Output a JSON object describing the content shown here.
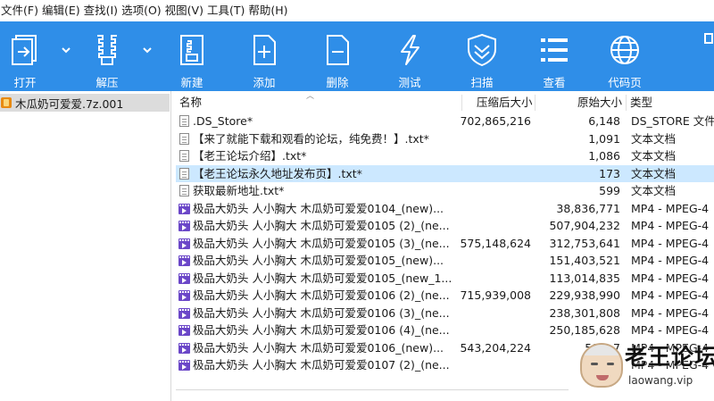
{
  "menu": [
    "文件(F)",
    "编辑(E)",
    "查找(I)",
    "选项(O)",
    "视图(V)",
    "工具(T)",
    "帮助(H)"
  ],
  "toolbar": [
    {
      "label": "打开",
      "icon": "open-icon"
    },
    {
      "label": "解压",
      "icon": "extract-icon"
    },
    {
      "label": "新建",
      "icon": "new-archive-icon"
    },
    {
      "label": "添加",
      "icon": "add-icon"
    },
    {
      "label": "删除",
      "icon": "delete-icon"
    },
    {
      "label": "测试",
      "icon": "test-icon"
    },
    {
      "label": "扫描",
      "icon": "scan-shield-icon"
    },
    {
      "label": "查看",
      "icon": "view-list-icon"
    },
    {
      "label": "代码页",
      "icon": "codepage-globe-icon"
    }
  ],
  "tree": {
    "item": "木瓜奶可爱爱.7z.001"
  },
  "columns": {
    "name": "名称",
    "packed": "压缩后大小",
    "size": "原始大小",
    "type": "类型"
  },
  "files": [
    {
      "name": ".DS_Store*",
      "packed": "702,865,216",
      "size": "6,148",
      "type": "DS_STORE 文件",
      "icon": "doc"
    },
    {
      "name": "【来了就能下载和观看的论坛，纯免费！】.txt*",
      "packed": "",
      "size": "1,091",
      "type": "文本文档",
      "icon": "doc"
    },
    {
      "name": "【老王论坛介绍】.txt*",
      "packed": "",
      "size": "1,086",
      "type": "文本文档",
      "icon": "doc"
    },
    {
      "name": "【老王论坛永久地址发布页】.txt*",
      "packed": "",
      "size": "173",
      "type": "文本文档",
      "icon": "doc",
      "selected": true
    },
    {
      "name": "获取最新地址.txt*",
      "packed": "",
      "size": "599",
      "type": "文本文档",
      "icon": "doc"
    },
    {
      "name": "极品大奶头 人小胸大  木瓜奶可爱爱0104_(new)...",
      "packed": "",
      "size": "38,836,771",
      "type": "MP4 - MPEG-4",
      "icon": "vid"
    },
    {
      "name": "极品大奶头 人小胸大  木瓜奶可爱爱0105 (2)_(ne...",
      "packed": "",
      "size": "507,904,232",
      "type": "MP4 - MPEG-4",
      "icon": "vid"
    },
    {
      "name": "极品大奶头 人小胸大  木瓜奶可爱爱0105 (3)_(ne...",
      "packed": "575,148,624",
      "size": "312,753,641",
      "type": "MP4 - MPEG-4",
      "icon": "vid"
    },
    {
      "name": "极品大奶头 人小胸大  木瓜奶可爱爱0105_(new)...",
      "packed": "",
      "size": "151,403,521",
      "type": "MP4 - MPEG-4",
      "icon": "vid"
    },
    {
      "name": "极品大奶头 人小胸大  木瓜奶可爱爱0105_(new_1...",
      "packed": "",
      "size": "113,014,835",
      "type": "MP4 - MPEG-4",
      "icon": "vid"
    },
    {
      "name": "极品大奶头 人小胸大  木瓜奶可爱爱0106 (2)_(ne...",
      "packed": "715,939,008",
      "size": "229,938,990",
      "type": "MP4 - MPEG-4",
      "icon": "vid"
    },
    {
      "name": "极品大奶头 人小胸大  木瓜奶可爱爱0106 (3)_(ne...",
      "packed": "",
      "size": "238,301,808",
      "type": "MP4 - MPEG-4",
      "icon": "vid"
    },
    {
      "name": "极品大奶头 人小胸大  木瓜奶可爱爱0106 (4)_(ne...",
      "packed": "",
      "size": "250,185,628",
      "type": "MP4 - MPEG-4",
      "icon": "vid"
    },
    {
      "name": "极品大奶头 人小胸大  木瓜奶可爱爱0106_(new)...",
      "packed": "543,204,224",
      "size": "58,...7",
      "type": "MP4 - MPEG-4",
      "icon": "vid"
    },
    {
      "name": "极品大奶头 人小胸大  木瓜奶可爱爱0107 (2)_(ne...",
      "packed": "",
      "size": "486...",
      "type": "MP4 - MPEG-4",
      "icon": "vid"
    }
  ],
  "watermark": {
    "title": "老王论坛",
    "url": "laowang.vip"
  },
  "colors": {
    "toolbar_bg": "#2f8ee8",
    "selected_row": "#cce8ff",
    "tree_selected": "#dcdcdc"
  }
}
